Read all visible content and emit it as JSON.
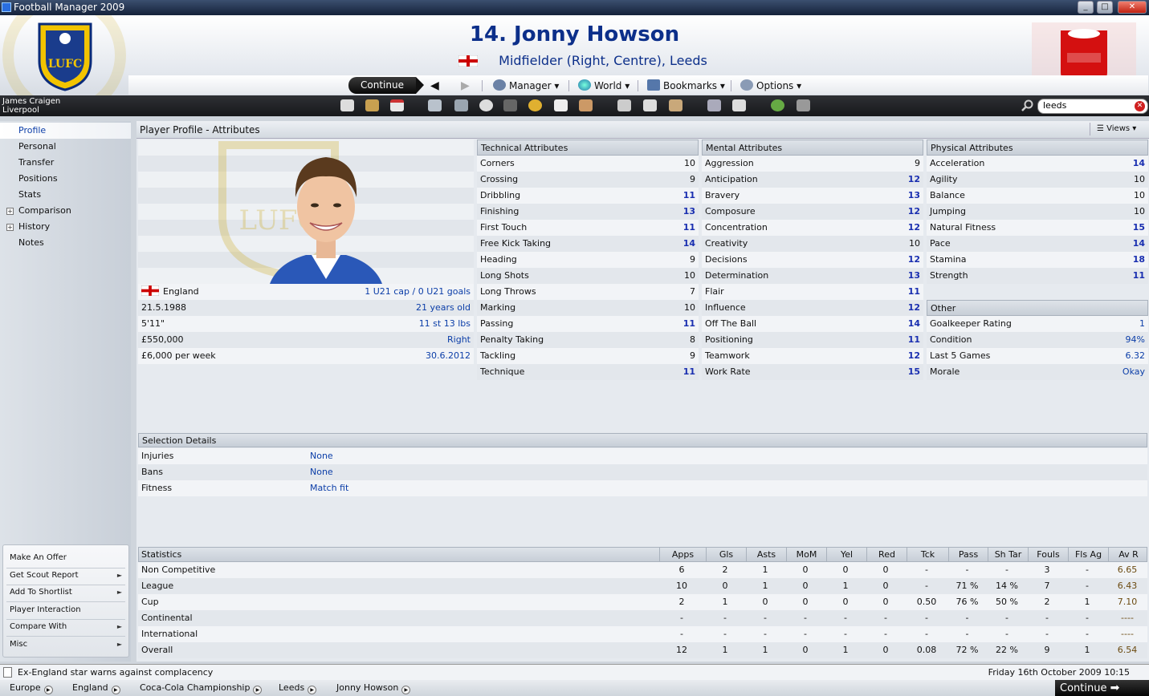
{
  "window": {
    "title": "Football Manager 2009"
  },
  "header": {
    "player_title": "14. Jonny Howson",
    "position_line": "Midfielder (Right, Centre), Leeds"
  },
  "menu": {
    "continue": "Continue",
    "manager": "Manager",
    "world": "World",
    "bookmarks": "Bookmarks",
    "options": "Options"
  },
  "toolbar": {
    "manager_name": "James Craigen",
    "manager_club": "Liverpool",
    "search_value": "leeds"
  },
  "sidebar": {
    "items": [
      "Profile",
      "Personal",
      "Transfer",
      "Positions",
      "Stats",
      "Comparison",
      "History",
      "Notes"
    ],
    "actions": [
      "Make An Offer",
      "Get Scout Report",
      "Add To Shortlist",
      "Player Interaction",
      "Compare With",
      "Misc"
    ]
  },
  "panel": {
    "title": "Player Profile - Attributes",
    "views": "Views"
  },
  "info": [
    {
      "left": "England",
      "right": "1 U21 cap / 0 U21 goals"
    },
    {
      "left": "21.5.1988",
      "right": "21 years old"
    },
    {
      "left": "5'11\"",
      "right": "11 st 13 lbs"
    },
    {
      "left": "£550,000",
      "right": "Right"
    },
    {
      "left": "£6,000 per week",
      "right": "30.6.2012"
    }
  ],
  "technical": {
    "title": "Technical Attributes",
    "rows": [
      [
        "Corners",
        "10"
      ],
      [
        "Crossing",
        "9"
      ],
      [
        "Dribbling",
        "11"
      ],
      [
        "Finishing",
        "13"
      ],
      [
        "First Touch",
        "11"
      ],
      [
        "Free Kick Taking",
        "14"
      ],
      [
        "Heading",
        "9"
      ],
      [
        "Long Shots",
        "10"
      ],
      [
        "Long Throws",
        "7"
      ],
      [
        "Marking",
        "10"
      ],
      [
        "Passing",
        "11"
      ],
      [
        "Penalty Taking",
        "8"
      ],
      [
        "Tackling",
        "9"
      ],
      [
        "Technique",
        "11"
      ]
    ]
  },
  "mental": {
    "title": "Mental Attributes",
    "rows": [
      [
        "Aggression",
        "9"
      ],
      [
        "Anticipation",
        "12"
      ],
      [
        "Bravery",
        "13"
      ],
      [
        "Composure",
        "12"
      ],
      [
        "Concentration",
        "12"
      ],
      [
        "Creativity",
        "10"
      ],
      [
        "Decisions",
        "12"
      ],
      [
        "Determination",
        "13"
      ],
      [
        "Flair",
        "11"
      ],
      [
        "Influence",
        "12"
      ],
      [
        "Off The Ball",
        "14"
      ],
      [
        "Positioning",
        "11"
      ],
      [
        "Teamwork",
        "12"
      ],
      [
        "Work Rate",
        "15"
      ]
    ]
  },
  "physical": {
    "title": "Physical Attributes",
    "rows": [
      [
        "Acceleration",
        "14"
      ],
      [
        "Agility",
        "10"
      ],
      [
        "Balance",
        "10"
      ],
      [
        "Jumping",
        "10"
      ],
      [
        "Natural Fitness",
        "15"
      ],
      [
        "Pace",
        "14"
      ],
      [
        "Stamina",
        "18"
      ],
      [
        "Strength",
        "11"
      ]
    ]
  },
  "other": {
    "title": "Other",
    "rows": [
      [
        "Goalkeeper Rating",
        "1"
      ],
      [
        "Condition",
        "94%"
      ],
      [
        "Last 5 Games",
        "6.32"
      ],
      [
        "Morale",
        "Okay"
      ]
    ]
  },
  "selection": {
    "title": "Selection Details",
    "rows": [
      [
        "Injuries",
        "None"
      ],
      [
        "Bans",
        "None"
      ],
      [
        "Fitness",
        "Match fit"
      ]
    ]
  },
  "statistics": {
    "title": "Statistics",
    "columns": [
      "Apps",
      "Gls",
      "Asts",
      "MoM",
      "Yel",
      "Red",
      "Tck",
      "Pass",
      "Sh Tar",
      "Fouls",
      "Fls Ag",
      "Av R"
    ],
    "rows": [
      {
        "label": "Non Competitive",
        "values": [
          "6",
          "2",
          "1",
          "0",
          "0",
          "0",
          "-",
          "-",
          "-",
          "3",
          "-",
          "6.65"
        ]
      },
      {
        "label": "League",
        "values": [
          "10",
          "0",
          "1",
          "0",
          "1",
          "0",
          "-",
          "71 %",
          "14 %",
          "7",
          "-",
          "6.43"
        ]
      },
      {
        "label": "Cup",
        "values": [
          "2",
          "1",
          "0",
          "0",
          "0",
          "0",
          "0.50",
          "76 %",
          "50 %",
          "2",
          "1",
          "7.10"
        ]
      },
      {
        "label": "Continental",
        "values": [
          "-",
          "-",
          "-",
          "-",
          "-",
          "-",
          "-",
          "-",
          "-",
          "-",
          "-",
          "----"
        ]
      },
      {
        "label": "International",
        "values": [
          "-",
          "-",
          "-",
          "-",
          "-",
          "-",
          "-",
          "-",
          "-",
          "-",
          "-",
          "----"
        ]
      },
      {
        "label": "Overall",
        "values": [
          "12",
          "1",
          "1",
          "0",
          "1",
          "0",
          "0.08",
          "72 %",
          "22 %",
          "9",
          "1",
          "6.54"
        ]
      }
    ]
  },
  "news": {
    "headline": "Ex-England star warns against complacency",
    "datetime": "Friday 16th October 2009 10:15"
  },
  "breadcrumbs": [
    "Europe",
    "England",
    "Coca-Cola Championship",
    "Leeds",
    "Jonny Howson"
  ],
  "bottom": {
    "continue": "Continue"
  },
  "colors": {
    "accent": "#0c2f8a",
    "link": "#0c3ea8",
    "highlight_value": "#1a2fb0"
  }
}
